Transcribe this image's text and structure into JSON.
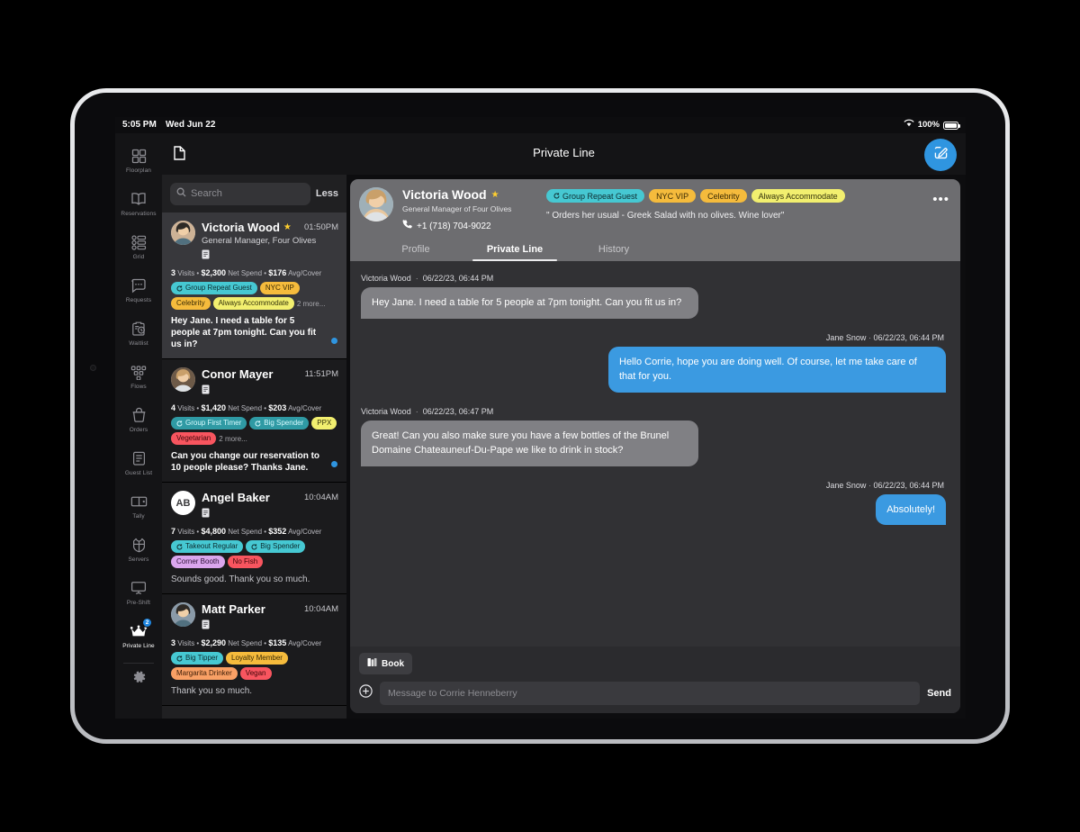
{
  "status_bar": {
    "time": "5:05 PM",
    "date": "Wed Jun 22",
    "battery": "100%",
    "wifi_icon": "wifi-icon",
    "battery_icon": "battery-icon"
  },
  "topbar": {
    "title": "Private Line",
    "doc_icon": "document-icon",
    "compose_icon": "compose-icon"
  },
  "rail": {
    "items": [
      {
        "label": "Floorplan",
        "icon": "grid-squares-icon",
        "active": false,
        "badge": ""
      },
      {
        "label": "Reservations",
        "icon": "open-book-icon",
        "active": false,
        "badge": ""
      },
      {
        "label": "Grid",
        "icon": "grid-rows-icon",
        "active": false,
        "badge": ""
      },
      {
        "label": "Requests",
        "icon": "chat-bubble-icon",
        "active": false,
        "badge": ""
      },
      {
        "label": "Waitlist",
        "icon": "clipboard-clock-icon",
        "active": false,
        "badge": ""
      },
      {
        "label": "Flows",
        "icon": "nodes-icon",
        "active": false,
        "badge": ""
      },
      {
        "label": "Orders",
        "icon": "takeout-bag-icon",
        "active": false,
        "badge": ""
      },
      {
        "label": "Guest List",
        "icon": "clipboard-list-icon",
        "active": false,
        "badge": ""
      },
      {
        "label": "Tally",
        "icon": "tally-box-icon",
        "active": false,
        "badge": ""
      },
      {
        "label": "Servers",
        "icon": "apron-icon",
        "active": false,
        "badge": ""
      },
      {
        "label": "Pre-Shift",
        "icon": "presentation-screen-icon",
        "active": false,
        "badge": ""
      },
      {
        "label": "Private Line",
        "icon": "crown-icon",
        "active": true,
        "badge": "2"
      }
    ],
    "settings_icon": "gear-icon"
  },
  "list": {
    "search": {
      "placeholder": "Search",
      "icon": "search-icon"
    },
    "less_label": "Less",
    "conversations": [
      {
        "name": "Victoria Wood",
        "starred": true,
        "time": "01:50PM",
        "subtitle": "General Manager, Four Olives",
        "note_icon": "note-icon",
        "visits": "3",
        "visits_label": "Visits",
        "net_spend": "$2,300",
        "net_spend_label": "Net Spend",
        "avg_cover": "$176",
        "avg_cover_label": "Avg/Cover",
        "tags": [
          {
            "label": "Group Repeat Guest",
            "bg": "#46c8d2",
            "fg": "#0d2b2e",
            "refresh": true
          },
          {
            "label": "NYC VIP",
            "bg": "#f5bb3c",
            "fg": "#3a2b05",
            "refresh": false
          },
          {
            "label": "Celebrity",
            "bg": "#f5bb3c",
            "fg": "#3a2b05",
            "refresh": false
          },
          {
            "label": "Always Accommodate",
            "bg": "#f2ef6f",
            "fg": "#33320a",
            "refresh": false
          }
        ],
        "more_label": "2 more...",
        "preview": "Hey Jane. I need a table for 5 people at 7pm tonight. Can you fit us in?",
        "unread": true,
        "selected": true,
        "avatar_type": "photo",
        "avatar_color": "#cdb296",
        "initials": ""
      },
      {
        "name": "Conor Mayer",
        "starred": false,
        "time": "11:51PM",
        "subtitle": "",
        "note_icon": "note-icon",
        "visits": "4",
        "visits_label": "Visits",
        "net_spend": "$1,420",
        "net_spend_label": "Net Spend",
        "avg_cover": "$203",
        "avg_cover_label": "Avg/Cover",
        "tags": [
          {
            "label": "Group First Timer",
            "bg": "#2f9aa4",
            "fg": "#d8fbff",
            "refresh": true
          },
          {
            "label": "Big Spender",
            "bg": "#2f9aa4",
            "fg": "#d8fbff",
            "refresh": true
          },
          {
            "label": "PPX",
            "bg": "#f2ef6f",
            "fg": "#33320a",
            "refresh": false
          },
          {
            "label": "Vegetarian",
            "bg": "#f8555f",
            "fg": "#3d0508",
            "refresh": false
          }
        ],
        "more_label": "2 more...",
        "preview": "Can you change our reservation to 10 people please? Thanks Jane.",
        "unread": true,
        "selected": false,
        "avatar_type": "photo",
        "avatar_color": "#6d5a48",
        "initials": ""
      },
      {
        "name": "Angel Baker",
        "starred": false,
        "time": "10:04AM",
        "subtitle": "",
        "note_icon": "note-icon",
        "visits": "7",
        "visits_label": "Visits",
        "net_spend": "$4,800",
        "net_spend_label": "Net Spend",
        "avg_cover": "$352",
        "avg_cover_label": "Avg/Cover",
        "tags": [
          {
            "label": "Takeout Regular",
            "bg": "#46c8d2",
            "fg": "#0d2b2e",
            "refresh": true
          },
          {
            "label": "Big Spender",
            "bg": "#46c8d2",
            "fg": "#0d2b2e",
            "refresh": true
          },
          {
            "label": "Corner Booth",
            "bg": "#dba6ee",
            "fg": "#2e1038",
            "refresh": false
          },
          {
            "label": "No Fish",
            "bg": "#f8555f",
            "fg": "#3d0508",
            "refresh": false
          }
        ],
        "more_label": "",
        "preview": "Sounds good. Thank you so much.",
        "unread": false,
        "selected": false,
        "avatar_type": "initials",
        "avatar_color": "#ffffff",
        "initials": "AB"
      },
      {
        "name": "Matt Parker",
        "starred": false,
        "time": "10:04AM",
        "subtitle": "",
        "note_icon": "note-icon",
        "visits": "3",
        "visits_label": "Visits",
        "net_spend": "$2,290",
        "net_spend_label": "Net Spend",
        "avg_cover": "$135",
        "avg_cover_label": "Avg/Cover",
        "tags": [
          {
            "label": "Big Tipper",
            "bg": "#46c8d2",
            "fg": "#0d2b2e",
            "refresh": true
          },
          {
            "label": "Loyalty Member",
            "bg": "#f5bb3c",
            "fg": "#3a2b05",
            "refresh": false
          },
          {
            "label": "Margarita Drinker",
            "bg": "#f9a065",
            "fg": "#40200a",
            "refresh": false
          },
          {
            "label": "Vegan",
            "bg": "#f8555f",
            "fg": "#3d0508",
            "refresh": false
          }
        ],
        "more_label": "",
        "preview": "Thank you so much.",
        "unread": false,
        "selected": false,
        "avatar_type": "photo",
        "avatar_color": "#8a9aa8",
        "initials": ""
      }
    ]
  },
  "detail": {
    "guest": {
      "name": "Victoria Wood",
      "starred": true,
      "star_icon": "star-icon",
      "role": "General Manager of Four Olives",
      "phone": "+1 (718) 704-9022",
      "phone_icon": "phone-icon",
      "note": "\" Orders her usual - Greek Salad with no olives. Wine lover\"",
      "more_icon": "ellipsis-icon",
      "tags": [
        {
          "label": "Group Repeat Guest",
          "bg": "#46c8d2",
          "fg": "#0d2b2e",
          "refresh": true
        },
        {
          "label": "NYC VIP",
          "bg": "#f5bb3c",
          "fg": "#3a2b05",
          "refresh": false
        },
        {
          "label": "Celebrity",
          "bg": "#f5bb3c",
          "fg": "#3a2b05",
          "refresh": false
        },
        {
          "label": "Always Accommodate",
          "bg": "#f2ef6f",
          "fg": "#33320a",
          "refresh": false
        }
      ]
    },
    "tabs": [
      {
        "label": "Profile",
        "active": false
      },
      {
        "label": "Private Line",
        "active": true
      },
      {
        "label": "History",
        "active": false
      }
    ],
    "messages": [
      {
        "sender": "Victoria Wood",
        "timestamp": "06/22/23, 06:44 PM",
        "text": "Hey Jane. I need a table for 5 people at 7pm tonight. Can you fit us in?",
        "direction": "incoming"
      },
      {
        "sender": "Jane Snow",
        "timestamp": "06/22/23, 06:44 PM",
        "text": "Hello Corrie, hope you are doing well. Of course, let me take care of that for you.",
        "direction": "outgoing"
      },
      {
        "sender": "Victoria Wood",
        "timestamp": "06/22/23, 06:47 PM",
        "text": "Great! Can you also make sure you have a few bottles of the Brunel Domaine Chateauneuf-Du-Pape we like to drink in stock?",
        "direction": "incoming"
      },
      {
        "sender": "Jane Snow",
        "timestamp": "06/22/23, 06:44 PM",
        "text": "Absolutely!",
        "direction": "outgoing"
      }
    ],
    "composer": {
      "book_label": "Book",
      "book_icon": "book-calendar-icon",
      "plus_icon": "plus-circle-icon",
      "placeholder": "Message to Corrie Henneberry",
      "send_label": "Send"
    }
  },
  "colors": {
    "accent": "#2f95e0",
    "bubble_out": "#3b9ae1",
    "bubble_in": "#808084",
    "header": "#6d6d70",
    "star": "#ffcf2e"
  }
}
